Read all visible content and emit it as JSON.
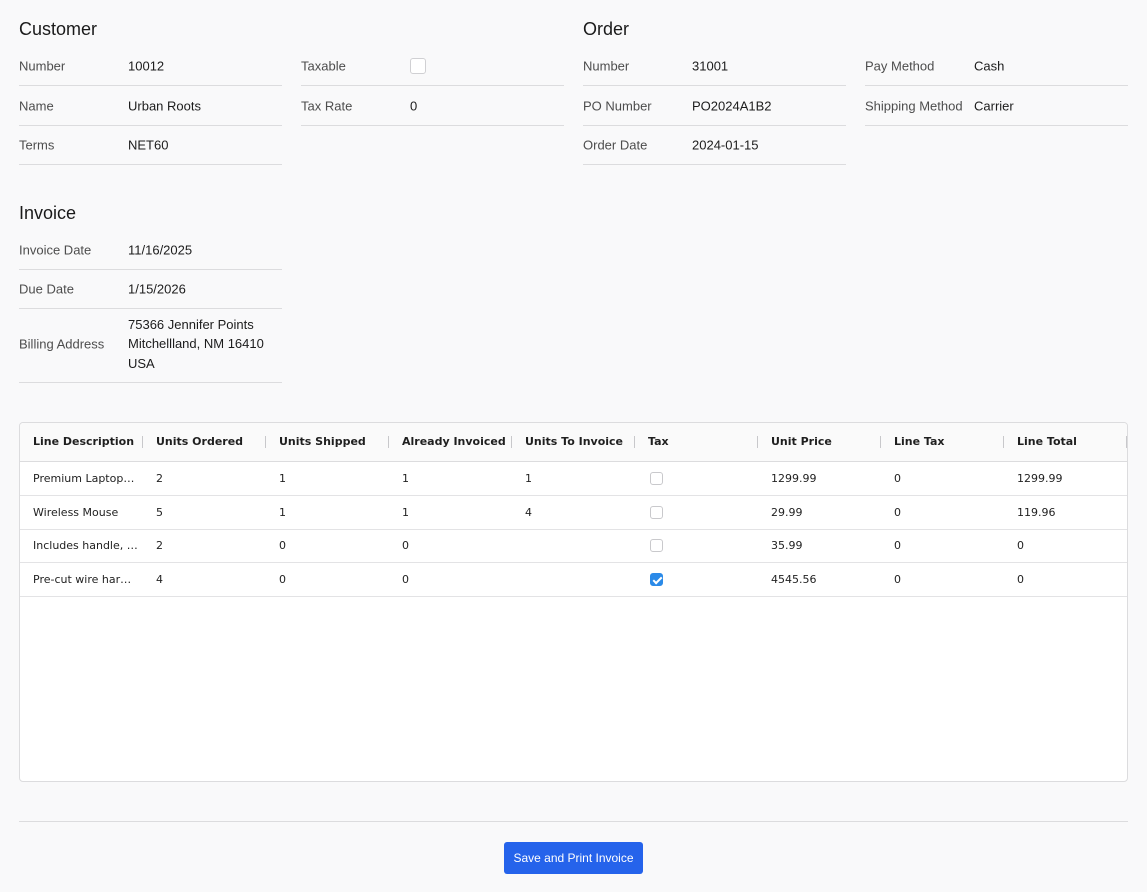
{
  "customer": {
    "title": "Customer",
    "number_label": "Number",
    "number": "10012",
    "name_label": "Name",
    "name": "Urban Roots",
    "terms_label": "Terms",
    "terms": "NET60",
    "taxable_label": "Taxable",
    "taxable": false,
    "tax_rate_label": "Tax Rate",
    "tax_rate": "0"
  },
  "order": {
    "title": "Order",
    "number_label": "Number",
    "number": "31001",
    "po_label": "PO Number",
    "po": "PO2024A1B2",
    "date_label": "Order Date",
    "date": "2024-01-15",
    "pay_method_label": "Pay Method",
    "pay_method": "Cash",
    "shipping_label": "Shipping Method",
    "shipping": "Carrier"
  },
  "invoice": {
    "title": "Invoice",
    "date_label": "Invoice Date",
    "date": "11/16/2025",
    "due_label": "Due Date",
    "due": "1/15/2026",
    "billing_label": "Billing Address",
    "billing_line1": "75366 Jennifer Points",
    "billing_line2": "Mitchellland, NM 16410",
    "billing_line3": "USA"
  },
  "grid": {
    "columns": [
      "Line Description",
      "Units Ordered",
      "Units Shipped",
      "Already Invoiced",
      "Units To Invoice",
      "Tax",
      "Unit Price",
      "Line Tax",
      "Line Total"
    ],
    "rows": [
      {
        "desc": "Premium Laptop…",
        "ordered": "2",
        "shipped": "1",
        "invoiced": "1",
        "to_invoice": "1",
        "tax": false,
        "price": "1299.99",
        "line_tax": "0",
        "total": "1299.99"
      },
      {
        "desc": "Wireless Mouse",
        "ordered": "5",
        "shipped": "1",
        "invoiced": "1",
        "to_invoice": "4",
        "tax": false,
        "price": "29.99",
        "line_tax": "0",
        "total": "119.96"
      },
      {
        "desc": "Includes handle, …",
        "ordered": "2",
        "shipped": "0",
        "invoiced": "0",
        "to_invoice": "",
        "tax": false,
        "price": "35.99",
        "line_tax": "0",
        "total": "0"
      },
      {
        "desc": "Pre-cut wire har…",
        "ordered": "4",
        "shipped": "0",
        "invoiced": "0",
        "to_invoice": "",
        "tax": true,
        "price": "4545.56",
        "line_tax": "0",
        "total": "0"
      }
    ]
  },
  "actions": {
    "save_print_label": "Save and Print Invoice"
  },
  "colors": {
    "accent": "#2563eb",
    "checkbox_checked": "#2b8ae8"
  }
}
